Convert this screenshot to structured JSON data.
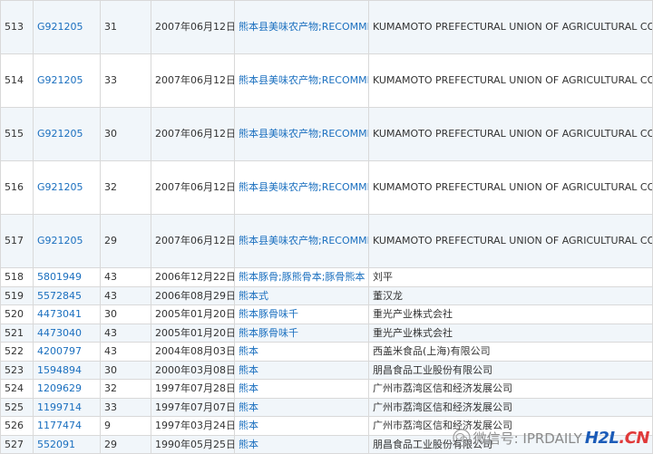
{
  "rows": [
    {
      "idx": "513",
      "reg": "G921205",
      "cls": "31",
      "date": "2007年06月12日",
      "mark": "熊本县美味农产物;RECOMMENDED BY KUMAMOTO JAPAN；IT’S TASTY",
      "owner": "KUMAMOTO PREFECTURAL UNION OF AGRICULTURAL CO-OPERATIVES"
    },
    {
      "idx": "514",
      "reg": "G921205",
      "cls": "33",
      "date": "2007年06月12日",
      "mark": "熊本县美味农产物;RECOMMENDED BY KUMAMOTO JAPAN；IT’S TASTY",
      "owner": "KUMAMOTO PREFECTURAL UNION OF AGRICULTURAL CO-OPERATIVES"
    },
    {
      "idx": "515",
      "reg": "G921205",
      "cls": "30",
      "date": "2007年06月12日",
      "mark": "熊本县美味农产物;RECOMMENDED BY KUMAMOTO JAPAN；IT’S TASTY",
      "owner": "KUMAMOTO PREFECTURAL UNION OF AGRICULTURAL CO-OPERATIVES"
    },
    {
      "idx": "516",
      "reg": "G921205",
      "cls": "32",
      "date": "2007年06月12日",
      "mark": "熊本县美味农产物;RECOMMENDED BY KUMAMOTO JAPAN；IT’S TASTY",
      "owner": "KUMAMOTO PREFECTURAL UNION OF AGRICULTURAL CO-OPERATIVES"
    },
    {
      "idx": "517",
      "reg": "G921205",
      "cls": "29",
      "date": "2007年06月12日",
      "mark": "熊本县美味农产物;RECOMMENDED BY KUMAMOTO JAPAN；IT’S TASTY",
      "owner": "KUMAMOTO PREFECTURAL UNION OF AGRICULTURAL CO-OPERATIVES"
    },
    {
      "idx": "518",
      "reg": "5801949",
      "cls": "43",
      "date": "2006年12月22日",
      "mark": "熊本豚骨;豚熊骨本;豚骨熊本",
      "owner": "刘平"
    },
    {
      "idx": "519",
      "reg": "5572845",
      "cls": "43",
      "date": "2006年08月29日",
      "mark": "熊本式",
      "owner": "董汉龙"
    },
    {
      "idx": "520",
      "reg": "4473041",
      "cls": "30",
      "date": "2005年01月20日",
      "mark": "熊本豚骨味千",
      "owner": "重光产业株式会社"
    },
    {
      "idx": "521",
      "reg": "4473040",
      "cls": "43",
      "date": "2005年01月20日",
      "mark": "熊本豚骨味千",
      "owner": "重光产业株式会社"
    },
    {
      "idx": "522",
      "reg": "4200797",
      "cls": "43",
      "date": "2004年08月03日",
      "mark": "熊本",
      "owner": "西盖米食品(上海)有限公司"
    },
    {
      "idx": "523",
      "reg": "1594894",
      "cls": "30",
      "date": "2000年03月08日",
      "mark": "熊本",
      "owner": "朋昌食品工业股份有限公司"
    },
    {
      "idx": "524",
      "reg": "1209629",
      "cls": "32",
      "date": "1997年07月28日",
      "mark": "熊本",
      "owner": "广州市荔湾区信和经济发展公司"
    },
    {
      "idx": "525",
      "reg": "1199714",
      "cls": "33",
      "date": "1997年07月07日",
      "mark": "熊本",
      "owner": "广州市荔湾区信和经济发展公司"
    },
    {
      "idx": "526",
      "reg": "1177474",
      "cls": "9",
      "date": "1997年03月24日",
      "mark": "熊本",
      "owner": "广州市荔湾区信和经济发展公司"
    },
    {
      "idx": "527",
      "reg": "552091",
      "cls": "29",
      "date": "1990年05月25日",
      "mark": "熊本",
      "owner": "朋昌食品工业股份有限公司"
    }
  ],
  "watermark": {
    "wechat_text": "微信号: IPRDAILY",
    "logo_h2l": "H2L",
    "logo_dot": ".",
    "logo_cn": "CN",
    "icon": "wechat-icon"
  }
}
